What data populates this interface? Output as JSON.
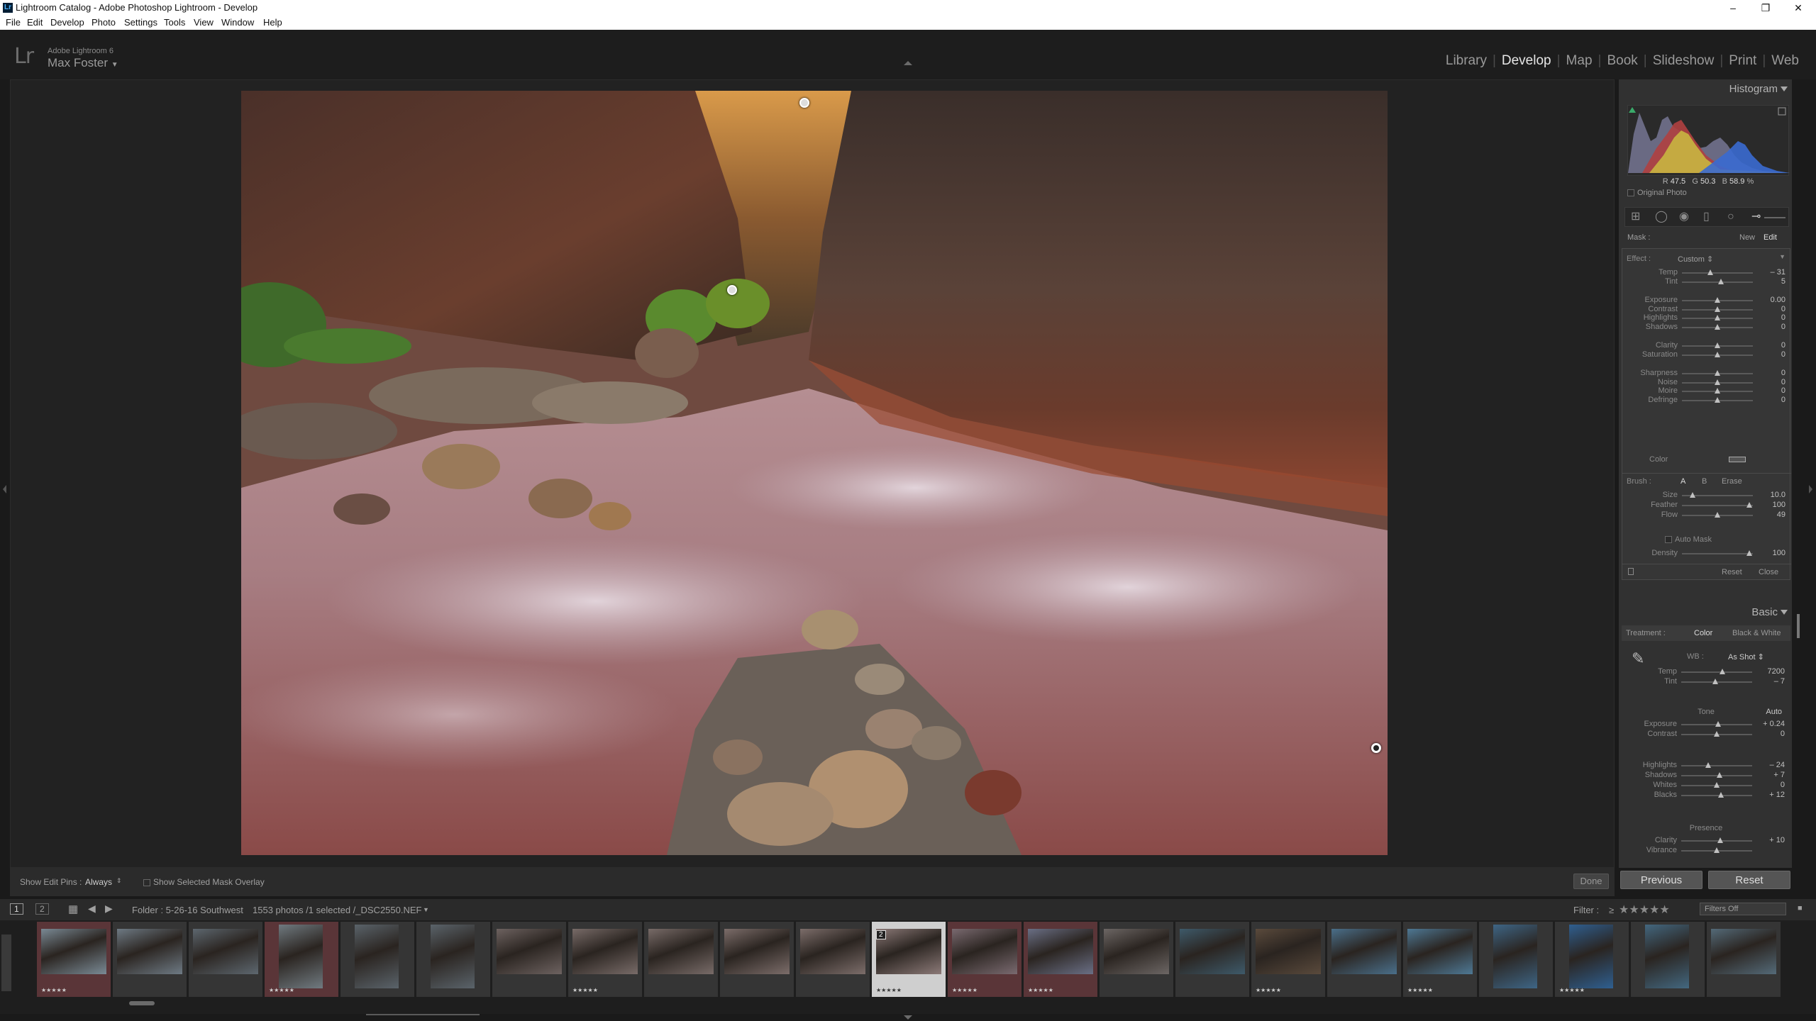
{
  "window": {
    "title": "Lightroom Catalog - Adobe Photoshop Lightroom - Develop",
    "app_icon": "Lr",
    "controls": [
      "–",
      "❐",
      "✕"
    ]
  },
  "menu": [
    "File",
    "Edit",
    "Develop",
    "Photo",
    "Settings",
    "Tools",
    "View",
    "Window",
    "Help"
  ],
  "identity": {
    "logo": "Lr",
    "product": "Adobe Lightroom 6",
    "user": "Max Foster",
    "user_arrow": "▼"
  },
  "modules": [
    {
      "label": "Library",
      "active": false
    },
    {
      "label": "Develop",
      "active": true
    },
    {
      "label": "Map",
      "active": false
    },
    {
      "label": "Book",
      "active": false
    },
    {
      "label": "Slideshow",
      "active": false
    },
    {
      "label": "Print",
      "active": false
    },
    {
      "label": "Web",
      "active": false
    }
  ],
  "toolbar": {
    "show_edit_pins_label": "Show Edit Pins :",
    "show_edit_pins_value": "Always",
    "overlay_label": "Show Selected Mask Overlay",
    "done": "Done"
  },
  "histogram": {
    "title": "Histogram",
    "r_label": "R",
    "r": "47.5",
    "g_label": "G",
    "g": "50.3",
    "b_label": "B",
    "b": "58.9",
    "unit": "%",
    "original_photo": "Original Photo"
  },
  "mask": {
    "label": "Mask :",
    "new": "New",
    "edit": "Edit"
  },
  "effect": {
    "label": "Effect :",
    "preset": "Custom",
    "sliders": [
      {
        "label": "Temp",
        "value": "– 31",
        "pos": 0.4
      },
      {
        "label": "Tint",
        "value": "5",
        "pos": 0.55
      },
      {
        "label": "Exposure",
        "value": "0.00",
        "pos": 0.5
      },
      {
        "label": "Contrast",
        "value": "0",
        "pos": 0.5
      },
      {
        "label": "Highlights",
        "value": "0",
        "pos": 0.5
      },
      {
        "label": "Shadows",
        "value": "0",
        "pos": 0.5
      },
      {
        "label": "Clarity",
        "value": "0",
        "pos": 0.5
      },
      {
        "label": "Saturation",
        "value": "0",
        "pos": 0.5
      },
      {
        "label": "Sharpness",
        "value": "0",
        "pos": 0.5
      },
      {
        "label": "Noise",
        "value": "0",
        "pos": 0.5
      },
      {
        "label": "Moire",
        "value": "0",
        "pos": 0.5
      },
      {
        "label": "Defringe",
        "value": "0",
        "pos": 0.5
      }
    ],
    "color_label": "Color"
  },
  "brush": {
    "label": "Brush :",
    "a": "A",
    "b": "B",
    "erase": "Erase",
    "sliders": [
      {
        "label": "Size",
        "value": "10.0",
        "pos": 0.15
      },
      {
        "label": "Feather",
        "value": "100",
        "pos": 0.95
      },
      {
        "label": "Flow",
        "value": "49",
        "pos": 0.5
      }
    ],
    "auto_mask": "Auto Mask",
    "density_label": "Density",
    "density_value": "100",
    "density_pos": 0.95,
    "reset": "Reset",
    "close": "Close"
  },
  "basic": {
    "title": "Basic",
    "treatment_label": "Treatment :",
    "color": "Color",
    "bw": "Black & White",
    "wb_label": "WB :",
    "wb_value": "As Shot",
    "wb_sliders": [
      {
        "label": "Temp",
        "value": "7200",
        "pos": 0.58
      },
      {
        "label": "Tint",
        "value": "– 7",
        "pos": 0.48
      }
    ],
    "tone_label": "Tone",
    "auto": "Auto",
    "tone_sliders": [
      {
        "label": "Exposure",
        "value": "+ 0.24",
        "pos": 0.52
      },
      {
        "label": "Contrast",
        "value": "0",
        "pos": 0.5
      }
    ],
    "tone_sliders2": [
      {
        "label": "Highlights",
        "value": "– 24",
        "pos": 0.38
      },
      {
        "label": "Shadows",
        "value": "+ 7",
        "pos": 0.54
      },
      {
        "label": "Whites",
        "value": "0",
        "pos": 0.5
      },
      {
        "label": "Blacks",
        "value": "+ 12",
        "pos": 0.56
      }
    ],
    "presence_label": "Presence",
    "presence_sliders": [
      {
        "label": "Clarity",
        "value": "+ 10",
        "pos": 0.55
      },
      {
        "label": "Vibrance",
        "value": "",
        "pos": 0.5
      }
    ]
  },
  "buttons": {
    "previous": "Previous",
    "reset": "Reset"
  },
  "filmstrip_bar": {
    "view1": "1",
    "view2": "2",
    "folder": "Folder : 5-26-16 Southwest",
    "count": "1553 photos /1 selected /_DSC2550.NEF",
    "filter_label": "Filter :",
    "filter_op": "≥",
    "filter_stars": "★★★★★",
    "filters_off": "Filters Off"
  },
  "filmstrip": [
    {
      "tone": "red",
      "stars": "★★★★★",
      "portrait": false,
      "hue": "#7a8a95"
    },
    {
      "tone": "norm",
      "stars": "",
      "portrait": false,
      "hue": "#6e7a84"
    },
    {
      "tone": "norm",
      "stars": "",
      "portrait": false,
      "hue": "#5d676f"
    },
    {
      "tone": "red",
      "stars": "★★★★★",
      "portrait": true,
      "hue": "#707a80"
    },
    {
      "tone": "norm",
      "stars": "",
      "portrait": true,
      "hue": "#5a636a"
    },
    {
      "tone": "norm",
      "stars": "",
      "portrait": true,
      "hue": "#5a636a"
    },
    {
      "tone": "norm",
      "stars": "",
      "portrait": false,
      "hue": "#6d6260"
    },
    {
      "tone": "norm",
      "stars": "★★★★★",
      "portrait": false,
      "hue": "#786b68"
    },
    {
      "tone": "norm",
      "stars": "",
      "portrait": false,
      "hue": "#786b68"
    },
    {
      "tone": "norm",
      "stars": "",
      "portrait": false,
      "hue": "#7c6d6a"
    },
    {
      "tone": "norm",
      "stars": "",
      "portrait": false,
      "hue": "#7c6d6a"
    },
    {
      "tone": "sel",
      "stars": "★★★★★",
      "portrait": false,
      "hue": "#8c7a78",
      "num": "2"
    },
    {
      "tone": "red",
      "stars": "★★★★★",
      "portrait": false,
      "hue": "#7a6a70"
    },
    {
      "tone": "red",
      "stars": "★★★★★",
      "portrait": false,
      "hue": "#6a6f85"
    },
    {
      "tone": "norm",
      "stars": "",
      "portrait": false,
      "hue": "#6c6664"
    },
    {
      "tone": "norm",
      "stars": "",
      "portrait": false,
      "hue": "#3e5a6a"
    },
    {
      "tone": "norm",
      "stars": "★★★★★",
      "portrait": false,
      "hue": "#5a4a3c"
    },
    {
      "tone": "norm",
      "stars": "",
      "portrait": false,
      "hue": "#4a6f8a"
    },
    {
      "tone": "norm",
      "stars": "★★★★★",
      "portrait": false,
      "hue": "#4e7894"
    },
    {
      "tone": "norm",
      "stars": "",
      "portrait": true,
      "hue": "#3e6585"
    },
    {
      "tone": "norm",
      "stars": "★★★★★",
      "portrait": true,
      "hue": "#2f5f90"
    },
    {
      "tone": "norm",
      "stars": "",
      "portrait": true,
      "hue": "#43677f"
    },
    {
      "tone": "norm",
      "stars": "",
      "portrait": false,
      "hue": "#546a78"
    }
  ],
  "icons": {
    "crop": "crop-icon",
    "spot": "spot-removal-icon",
    "redeye": "red-eye-icon",
    "grad": "graduated-filter-icon",
    "radial": "radial-filter-icon",
    "brush": "adjustment-brush-icon",
    "eyedropper": "eyedropper-icon"
  }
}
